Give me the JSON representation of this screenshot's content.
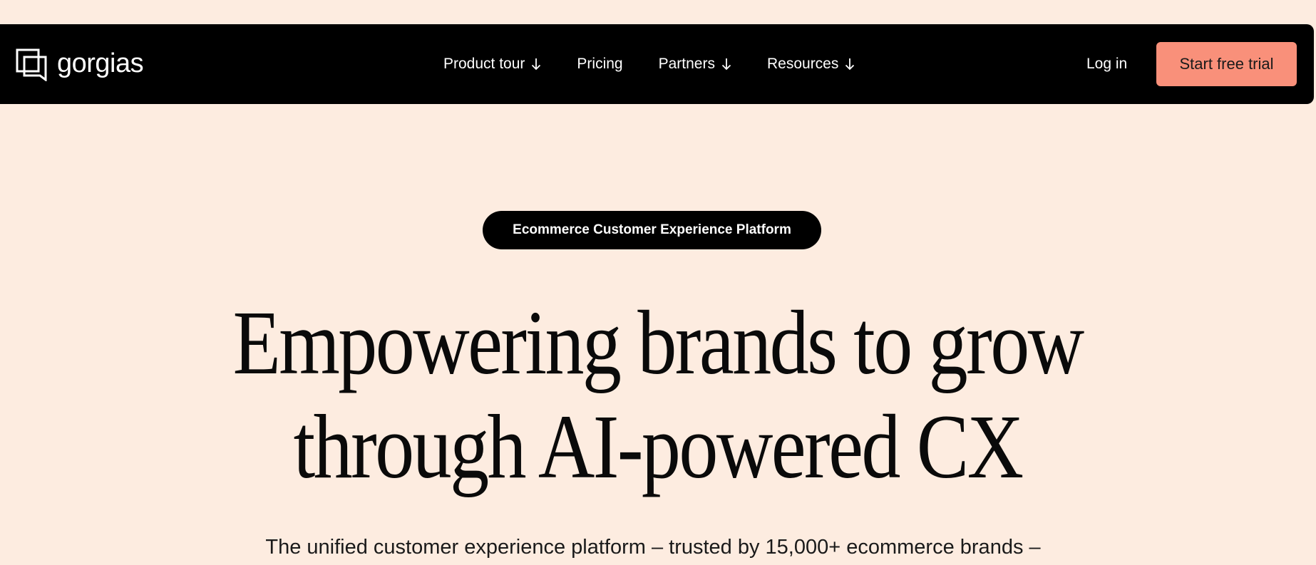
{
  "nav": {
    "logo_text": "gorgias",
    "items": [
      {
        "label": "Product tour",
        "has_dropdown": true
      },
      {
        "label": "Pricing",
        "has_dropdown": false
      },
      {
        "label": "Partners",
        "has_dropdown": true
      },
      {
        "label": "Resources",
        "has_dropdown": true
      }
    ],
    "login_label": "Log in",
    "cta_label": "Start free trial"
  },
  "hero": {
    "badge": "Ecommerce Customer Experience Platform",
    "headline_line1": "Empowering brands to grow",
    "headline_line2": "through AI-powered CX",
    "subtitle": "The unified customer experience platform – trusted by 15,000+ ecommerce brands –"
  },
  "colors": {
    "background": "#fdece0",
    "navbar": "#000000",
    "cta_background": "#f9907a",
    "badge_background": "#000000"
  },
  "icons": {
    "logo": "gorgias-logo-icon",
    "dropdown": "arrow-down-icon"
  }
}
